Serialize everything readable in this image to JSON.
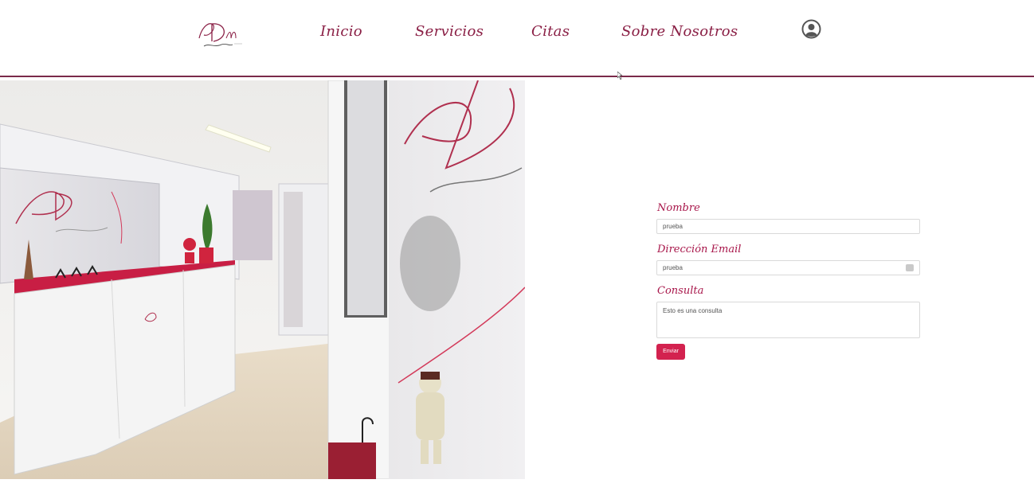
{
  "nav": {
    "logo_text": "ADM advocats",
    "items": [
      {
        "label": "Inicio"
      },
      {
        "label": "Servicios"
      },
      {
        "label": "Citas"
      },
      {
        "label": "Sobre Nosotros"
      }
    ],
    "user_icon": "user-circle-icon"
  },
  "hero": {
    "image_label": "office-interior-photo"
  },
  "form": {
    "name_label": "Nombre",
    "name_value": "prueba",
    "email_label": "Dirección Email",
    "email_value": "prueba",
    "query_label": "Consulta",
    "query_value": "Esto es una consulta",
    "submit_label": "Enviar"
  },
  "colors": {
    "brand": "#8a1f45",
    "button": "#d3224f",
    "header_line": "#7a2a4a"
  }
}
